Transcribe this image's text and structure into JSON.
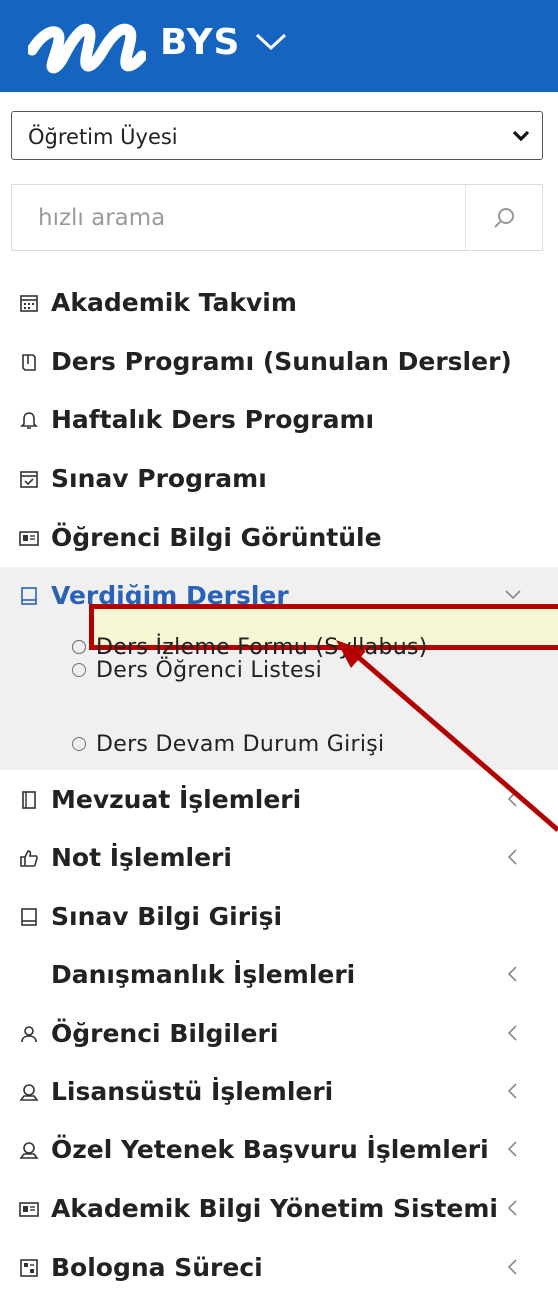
{
  "header": {
    "brand": "BYS",
    "brand_color": "#1565c0"
  },
  "role_select": {
    "value": "Öğretim Üyesi"
  },
  "search": {
    "placeholder": "hızlı arama"
  },
  "menu": {
    "items": [
      {
        "label": "Akademik Takvim",
        "icon": "calendar-icon"
      },
      {
        "label": "Ders Programı (Sunulan Dersler)",
        "icon": "book-icon"
      },
      {
        "label": "Haftalık Ders Programı",
        "icon": "bell-icon"
      },
      {
        "label": "Sınav Programı",
        "icon": "calendar-check-icon"
      },
      {
        "label": "Öğrenci Bilgi Görüntüle",
        "icon": "id-card-icon"
      },
      {
        "label": "Verdiğim Dersler",
        "icon": "notebook-icon",
        "expanded": true,
        "children": [
          {
            "label": "Ders İzleme Formu (Syllabus)"
          },
          {
            "label": "Ders Öğrenci Listesi"
          },
          {
            "label": "Ders Devam Durum Girişi"
          }
        ]
      },
      {
        "label": "Mevzuat İşlemleri",
        "icon": "document-icon"
      },
      {
        "label": "Not İşlemleri",
        "icon": "thumbs-up-icon"
      },
      {
        "label": "Sınav Bilgi Girişi",
        "icon": "notebook-icon"
      },
      {
        "label": "Danışmanlık İşlemleri",
        "icon": ""
      },
      {
        "label": "Öğrenci Bilgileri",
        "icon": "user-icon"
      },
      {
        "label": "Lisansüstü İşlemleri",
        "icon": "graduate-icon"
      },
      {
        "label": "Özel Yetenek Başvuru İşlemleri",
        "icon": "graduate-icon"
      },
      {
        "label": "Akademik Bilgi Yönetim Sistemi",
        "icon": "id-card-icon"
      },
      {
        "label": "Bologna Süreci",
        "icon": "grid-icon"
      }
    ]
  },
  "annotation_color": "#b30000",
  "active_color": "#2a62b8"
}
